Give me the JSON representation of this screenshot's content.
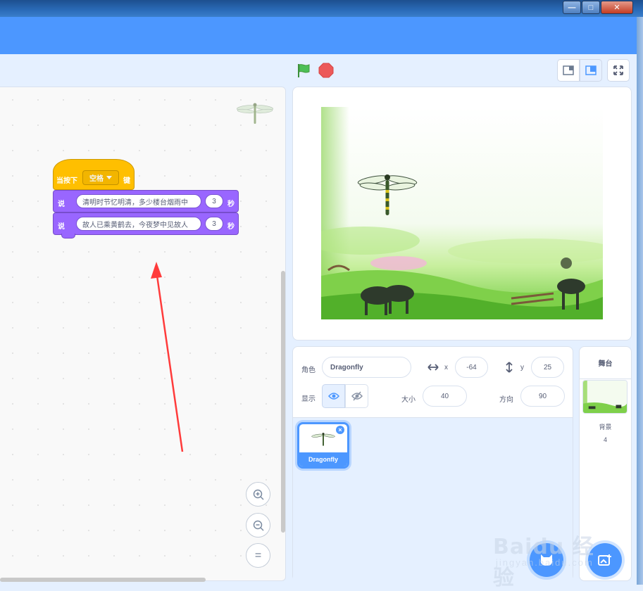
{
  "window": {
    "min": "—",
    "max": "□",
    "close": "✕"
  },
  "stage_controls": {
    "green_flag": "green-flag-icon",
    "stop": "stop-icon"
  },
  "code": {
    "hat": {
      "label": "当按下",
      "key": "空格",
      "suffix": "键"
    },
    "say_blocks": [
      {
        "label": "说",
        "text": "清明时节忆明清，多少楼台烟雨中",
        "secs": "3",
        "unit": "秒"
      },
      {
        "label": "说",
        "text": "故人已乘黄鹤去，今夜梦中见故人",
        "secs": "3",
        "unit": "秒"
      }
    ],
    "zoom": {
      "in": "+",
      "out": "−",
      "reset": "="
    }
  },
  "sprite_info": {
    "sprite_label": "角色",
    "sprite_name": "Dragonfly",
    "x_label": "x",
    "x_value": "-64",
    "y_label": "y",
    "y_value": "25",
    "show_label": "显示",
    "size_label": "大小",
    "size_value": "40",
    "direction_label": "方向",
    "direction_value": "90"
  },
  "sprites": [
    {
      "name": "Dragonfly",
      "delete": "×"
    }
  ],
  "stage_panel": {
    "header": "舞台",
    "backdrop_label": "背景",
    "backdrop_count": "4"
  },
  "watermark": {
    "text": "Baidu 经验",
    "url": "jingyan.baidu.com"
  },
  "colors": {
    "accent": "#4c97ff",
    "events": "#ffbf00",
    "looks": "#9966ff",
    "annotation": "#ff3b3b"
  }
}
